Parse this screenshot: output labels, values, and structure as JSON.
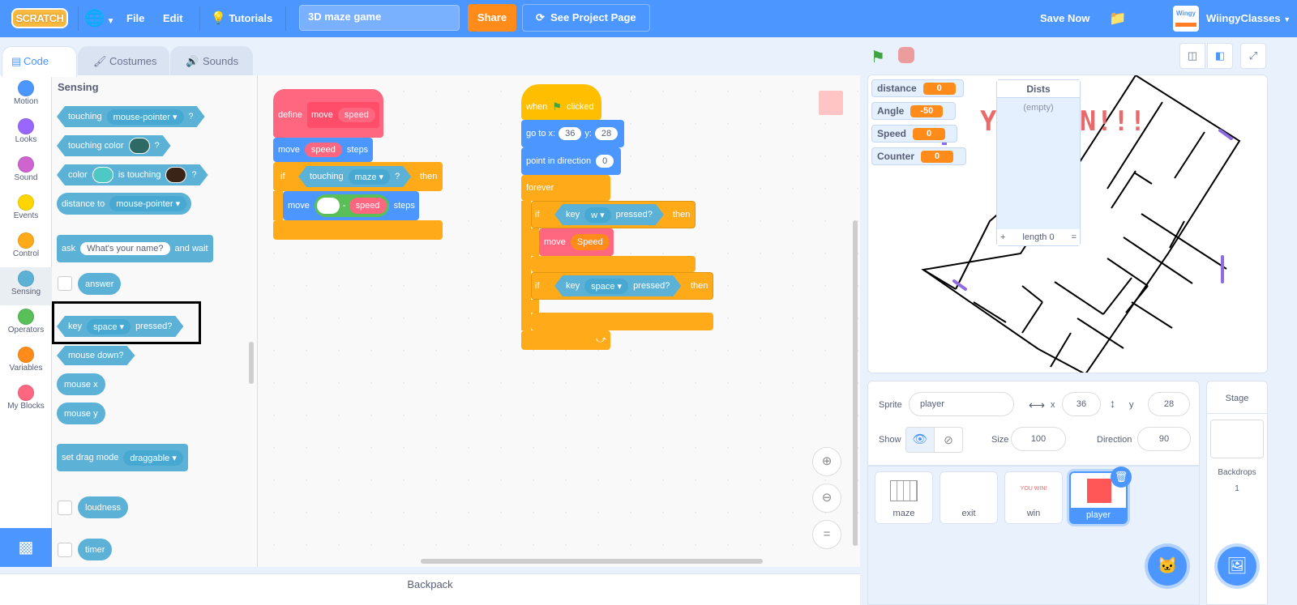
{
  "menubar": {
    "logo": "SCRATCH",
    "language_icon": "globe-icon",
    "file": "File",
    "edit": "Edit",
    "tutorials": "Tutorials",
    "project_title": "3D maze game",
    "share": "Share",
    "see_project_page": "See Project Page",
    "save_now": "Save Now",
    "username": "WiingyClasses",
    "avatar_text": "Wingy"
  },
  "tabs": [
    {
      "label": "Code",
      "active": true,
      "icon": "code-icon"
    },
    {
      "label": "Costumes",
      "active": false,
      "icon": "brush-icon"
    },
    {
      "label": "Sounds",
      "active": false,
      "icon": "speaker-icon"
    }
  ],
  "categories": [
    {
      "label": "Motion",
      "color": "#4c97ff"
    },
    {
      "label": "Looks",
      "color": "#9966ff"
    },
    {
      "label": "Sound",
      "color": "#cf63cf"
    },
    {
      "label": "Events",
      "color": "#ffd500"
    },
    {
      "label": "Control",
      "color": "#ffab19"
    },
    {
      "label": "Sensing",
      "color": "#5cb1d6"
    },
    {
      "label": "Operators",
      "color": "#59c059"
    },
    {
      "label": "Variables",
      "color": "#ff8c1a"
    },
    {
      "label": "My Blocks",
      "color": "#ff6680"
    }
  ],
  "palette": {
    "heading": "Sensing",
    "touching": {
      "text": "touching",
      "dropdown": "mouse-pointer",
      "suffix": "?"
    },
    "touching_color": {
      "text": "touching color",
      "suffix": "?",
      "color": "#2d6a66"
    },
    "color_touching": {
      "text1": "color",
      "text2": "is touching",
      "suffix": "?",
      "color1": "#4fc7c5",
      "color2": "#3a2418"
    },
    "distance_to": {
      "text": "distance to",
      "dropdown": "mouse-pointer"
    },
    "ask": {
      "text1": "ask",
      "input": "What's your name?",
      "text2": "and wait"
    },
    "answer": "answer",
    "key_pressed": {
      "text1": "key",
      "dropdown": "space",
      "text2": "pressed?"
    },
    "mouse_down": "mouse down?",
    "mouse_x": "mouse x",
    "mouse_y": "mouse y",
    "set_drag_mode": {
      "text": "set drag mode",
      "dropdown": "draggable"
    },
    "loudness": "loudness",
    "timer": "timer"
  },
  "script1": {
    "define": "define",
    "name": "move",
    "param": "speed",
    "move": "move",
    "steps": "steps",
    "if": "if",
    "then": "then",
    "touching": "touching",
    "touching_dd": "maze",
    "q": "?",
    "minus": "-",
    "minus_left": ""
  },
  "script2": {
    "when": "when",
    "clicked": "clicked",
    "goto": "go to x:",
    "x": "36",
    "y_label": "y:",
    "y": "28",
    "point": "point in direction",
    "dir": "0",
    "forever": "forever",
    "if": "if",
    "then": "then",
    "key": "key",
    "key1": "w",
    "pressed": "pressed?",
    "move": "move",
    "speed_var": "Speed",
    "key2": "space"
  },
  "backpack": "Backpack",
  "stage": {
    "monitors": [
      {
        "label": "distance",
        "value": "0"
      },
      {
        "label": "Angle",
        "value": "-50"
      },
      {
        "label": "Speed",
        "value": "0"
      },
      {
        "label": "Counter",
        "value": "0"
      }
    ],
    "list": {
      "title": "Dists",
      "empty": "(empty)",
      "add": "+",
      "length": "length 0",
      "resize": "="
    },
    "banner_text": "YOU WIN!!!"
  },
  "sprite_info": {
    "sprite_label": "Sprite",
    "sprite_name": "player",
    "x_label": "x",
    "x": "36",
    "y_label": "y",
    "y": "28",
    "show_label": "Show",
    "size_label": "Size",
    "size": "100",
    "direction_label": "Direction",
    "direction": "90"
  },
  "sprites": [
    {
      "name": "maze",
      "selected": false
    },
    {
      "name": "exit",
      "selected": false
    },
    {
      "name": "win",
      "selected": false,
      "thumb_text": "YOU WIN!"
    },
    {
      "name": "player",
      "selected": true,
      "color": "#ff5757"
    }
  ],
  "stage_pane": {
    "title": "Stage",
    "backdrops_label": "Backdrops",
    "backdrops_count": "1"
  }
}
